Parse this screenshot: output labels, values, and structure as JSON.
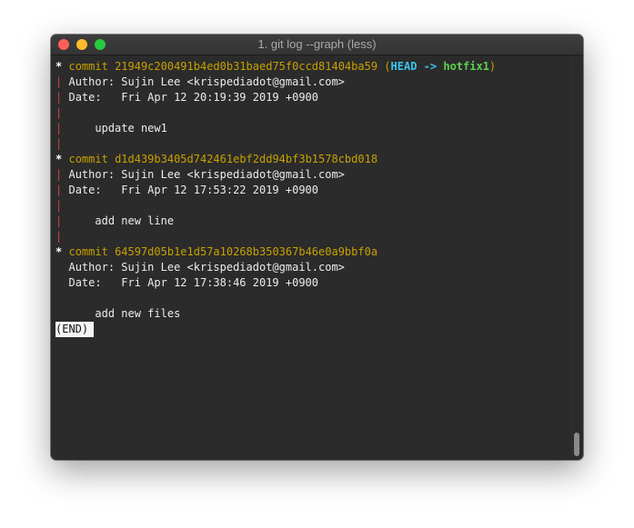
{
  "window": {
    "title": "1. git log --graph (less)"
  },
  "commits": [
    {
      "graph_char": "*",
      "commit_keyword": "commit",
      "hash": "21949c200491b4ed0b31baed75f0ccd81404ba59",
      "refs": {
        "open": "(",
        "head": "HEAD",
        "arrow": "->",
        "branch": "hotfix1",
        "close": ")"
      },
      "author_line": "Author: Sujin Lee <krispediadot@gmail.com>",
      "date_line": "Date:   Fri Apr 12 20:19:39 2019 +0900",
      "message": "    update new1"
    },
    {
      "graph_char": "*",
      "commit_keyword": "commit",
      "hash": "d1d439b3405d742461ebf2dd94bf3b1578cbd018",
      "author_line": "Author: Sujin Lee <krispediadot@gmail.com>",
      "date_line": "Date:   Fri Apr 12 17:53:22 2019 +0900",
      "message": "    add new line"
    },
    {
      "graph_char": "*",
      "commit_keyword": "commit",
      "hash": "64597d05b1e1d57a10268b350367b46e0a9bbf0a",
      "author_line": "Author: Sujin Lee <krispediadot@gmail.com>",
      "date_line": "Date:   Fri Apr 12 17:38:46 2019 +0900",
      "message": "    add new files"
    }
  ],
  "graph": {
    "pipe": "|",
    "blank": " "
  },
  "pager": {
    "end_label": "(END)"
  },
  "colors": {
    "background": "#2b2b2b",
    "text": "#ececec",
    "hash": "#c7a000",
    "head": "#38c4ee",
    "branch": "#5dd14f",
    "graph_pipe": "#c04a3c",
    "close_button": "#fe5f57",
    "minimize_button": "#febc2e",
    "zoom_button": "#28c840"
  },
  "icons": {
    "close": "close-button-icon",
    "minimize": "minimize-button-icon",
    "zoom": "zoom-button-icon"
  }
}
